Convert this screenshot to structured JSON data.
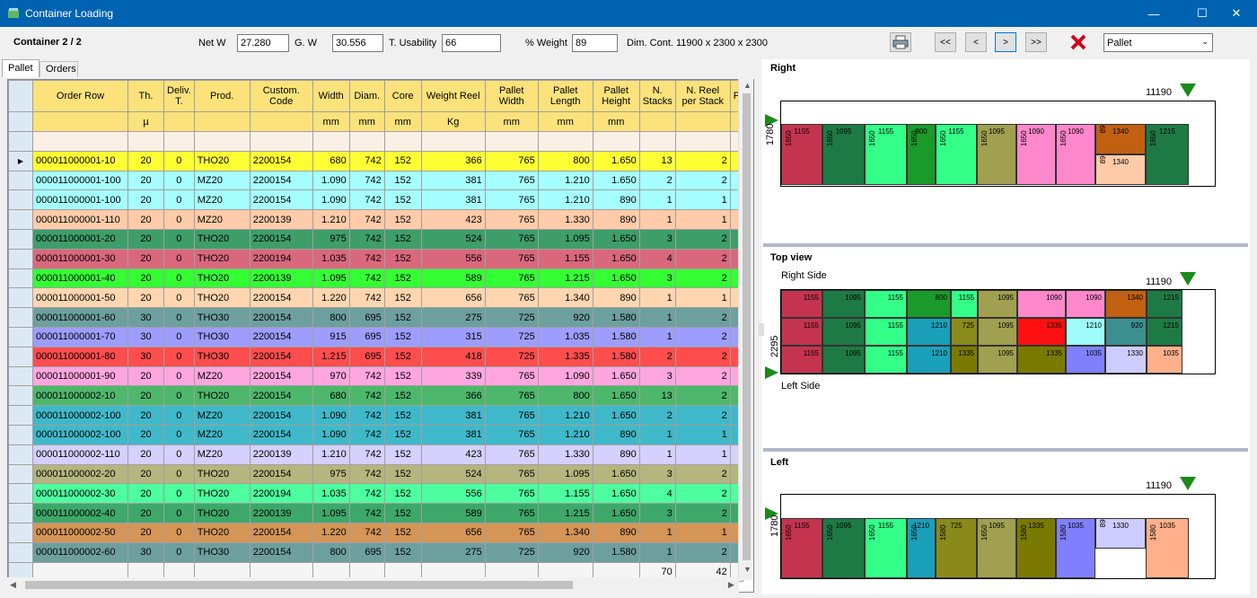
{
  "window": {
    "title": "Container Loading",
    "min": "—",
    "max": "☐",
    "close": "✕"
  },
  "toolbar": {
    "container_label": "Container 2 / 2",
    "netw_label": "Net W",
    "netw_value": "27.280",
    "gw_label": "G. W",
    "gw_value": "30.556",
    "usab_label": "T. Usability",
    "usab_value": "66",
    "pweight_label": "% Weight",
    "pweight_value": "89",
    "dim_label": "Dim. Cont. 11900 x 2300 x 2300",
    "first": "<<",
    "prev": "<",
    "next": ">",
    "last": ">>",
    "select_value": "Pallet"
  },
  "tabs": [
    "Pallet",
    "Orders"
  ],
  "grid": {
    "headers": [
      "Order Row",
      "Th.",
      "Deliv. T.",
      "Prod.",
      "Custom. Code",
      "Width",
      "Diam.",
      "Core",
      "Weight Reel",
      "Pallet Width",
      "Pallet Length",
      "Pallet Height",
      "N. Stacks",
      "N. Reel per Stack",
      "P"
    ],
    "units": [
      "",
      "µ",
      "",
      "",
      "",
      "mm",
      "mm",
      "mm",
      "Kg",
      "mm",
      "mm",
      "mm",
      "",
      "",
      ""
    ],
    "rows": [
      [
        "000011000001-10",
        "20",
        "0",
        "THO20",
        "2200154",
        "680",
        "742",
        "152",
        "366",
        "765",
        "800",
        "1.650",
        "13",
        "2",
        "#ffff33"
      ],
      [
        "000011000001-100",
        "20",
        "0",
        "MZ20",
        "2200154",
        "1.090",
        "742",
        "152",
        "381",
        "765",
        "1.210",
        "1.650",
        "2",
        "2",
        "#a6ffff"
      ],
      [
        "000011000001-100",
        "20",
        "0",
        "MZ20",
        "2200154",
        "1.090",
        "742",
        "152",
        "381",
        "765",
        "1.210",
        "890",
        "1",
        "1",
        "#a6ffff"
      ],
      [
        "000011000001-110",
        "20",
        "0",
        "MZ20",
        "2200139",
        "1.210",
        "742",
        "152",
        "423",
        "765",
        "1.330",
        "890",
        "1",
        "1",
        "#ffcba8"
      ],
      [
        "000011000001-20",
        "20",
        "0",
        "THO20",
        "2200154",
        "975",
        "742",
        "152",
        "524",
        "765",
        "1.095",
        "1.650",
        "3",
        "2",
        "#3e9e6a"
      ],
      [
        "000011000001-30",
        "20",
        "0",
        "THO20",
        "2200194",
        "1.035",
        "742",
        "152",
        "556",
        "765",
        "1.155",
        "1.650",
        "4",
        "2",
        "#d9687d"
      ],
      [
        "000011000001-40",
        "20",
        "0",
        "THO20",
        "2200139",
        "1.095",
        "742",
        "152",
        "589",
        "765",
        "1.215",
        "1.650",
        "3",
        "2",
        "#33ff33"
      ],
      [
        "000011000001-50",
        "20",
        "0",
        "THO20",
        "2200154",
        "1.220",
        "742",
        "152",
        "656",
        "765",
        "1.340",
        "890",
        "1",
        "1",
        "#ffd6b0"
      ],
      [
        "000011000001-60",
        "30",
        "0",
        "THO30",
        "2200154",
        "800",
        "695",
        "152",
        "275",
        "725",
        "920",
        "1.580",
        "1",
        "2",
        "#6e9f9f"
      ],
      [
        "000011000001-70",
        "30",
        "0",
        "THO30",
        "2200154",
        "915",
        "695",
        "152",
        "315",
        "725",
        "1.035",
        "1.580",
        "1",
        "2",
        "#9d9dff"
      ],
      [
        "000011000001-80",
        "30",
        "0",
        "THO30",
        "2200154",
        "1.215",
        "695",
        "152",
        "418",
        "725",
        "1.335",
        "1.580",
        "2",
        "2",
        "#ff4d4d"
      ],
      [
        "000011000001-90",
        "20",
        "0",
        "MZ20",
        "2200154",
        "970",
        "742",
        "152",
        "339",
        "765",
        "1.090",
        "1.650",
        "3",
        "2",
        "#ffa6e0"
      ],
      [
        "000011000002-10",
        "20",
        "0",
        "THO20",
        "2200154",
        "680",
        "742",
        "152",
        "366",
        "765",
        "800",
        "1.650",
        "13",
        "2",
        "#4db86b"
      ],
      [
        "000011000002-100",
        "20",
        "0",
        "MZ20",
        "2200154",
        "1.090",
        "742",
        "152",
        "381",
        "765",
        "1.210",
        "1.650",
        "2",
        "2",
        "#3fb9c9"
      ],
      [
        "000011000002-100",
        "20",
        "0",
        "MZ20",
        "2200154",
        "1.090",
        "742",
        "152",
        "381",
        "765",
        "1.210",
        "890",
        "1",
        "1",
        "#3fb9c9"
      ],
      [
        "000011000002-110",
        "20",
        "0",
        "MZ20",
        "2200139",
        "1.210",
        "742",
        "152",
        "423",
        "765",
        "1.330",
        "890",
        "1",
        "1",
        "#d4d0ff"
      ],
      [
        "000011000002-20",
        "20",
        "0",
        "THO20",
        "2200154",
        "975",
        "742",
        "152",
        "524",
        "765",
        "1.095",
        "1.650",
        "3",
        "2",
        "#b5b57e"
      ],
      [
        "000011000002-30",
        "20",
        "0",
        "THO20",
        "2200194",
        "1.035",
        "742",
        "152",
        "556",
        "765",
        "1.155",
        "1.650",
        "4",
        "2",
        "#4dff9e"
      ],
      [
        "000011000002-40",
        "20",
        "0",
        "THO20",
        "2200139",
        "1.095",
        "742",
        "152",
        "589",
        "765",
        "1.215",
        "1.650",
        "3",
        "2",
        "#3da86a"
      ],
      [
        "000011000002-50",
        "20",
        "0",
        "THO20",
        "2200154",
        "1.220",
        "742",
        "152",
        "656",
        "765",
        "1.340",
        "890",
        "1",
        "1",
        "#d49557"
      ],
      [
        "000011000002-60",
        "30",
        "0",
        "THO30",
        "2200154",
        "800",
        "695",
        "152",
        "275",
        "725",
        "920",
        "1.580",
        "1",
        "2",
        "#6e9f9f"
      ]
    ],
    "totals": {
      "stacks": "70",
      "reels": "42"
    }
  },
  "views": {
    "right": {
      "title": "Right",
      "length": "11190",
      "height": "1780"
    },
    "top": {
      "title": "Top view",
      "right_side": "Right Side",
      "left_side": "Left Side",
      "length": "11190",
      "width": "2295"
    },
    "left": {
      "title": "Left",
      "length": "11190",
      "height": "1780"
    }
  },
  "blocks": {
    "right": [
      {
        "c": "#c4344f",
        "w": "1155",
        "h": "1650"
      },
      {
        "c": "#1e7a45",
        "w": "1095",
        "h": "1650"
      },
      {
        "c": "#33ff88",
        "w": "1155",
        "h": "1650"
      },
      {
        "c": "#1a9a2a",
        "w": "800",
        "h": "1650"
      },
      {
        "c": "#33ff88",
        "w": "1155",
        "h": "1650"
      },
      {
        "c": "#a0a050",
        "w": "1095",
        "h": "1650"
      },
      {
        "c": "#ff88cc",
        "w": "1090",
        "h": "1650"
      },
      {
        "c": "#ff88cc",
        "w": "1090",
        "h": "1650"
      },
      {
        "c": "#c06010",
        "w": "1340",
        "h": "890"
      },
      {
        "c": "#ffcba8",
        "w": "1340",
        "h": "890"
      },
      {
        "c": "#1e7a45",
        "w": "1215",
        "h": "1650"
      }
    ],
    "top": [
      [
        "1155",
        "1095",
        "1155",
        "800",
        "1155",
        "1095",
        "1090",
        "1090",
        "1340",
        "1215"
      ],
      [
        "1155",
        "1095",
        "1155",
        "1210",
        "725",
        "1095",
        "1335",
        "1210",
        "920",
        "1215"
      ],
      [
        "1155",
        "1095",
        "1155",
        "1210",
        "1335",
        "1095",
        "1335",
        "1035",
        "1330",
        "1035"
      ]
    ],
    "left": [
      {
        "c": "#c4344f",
        "w": "1155",
        "h": "1650"
      },
      {
        "c": "#1e7a45",
        "w": "1095",
        "h": "1650"
      },
      {
        "c": "#33ff88",
        "w": "1155",
        "h": "1650"
      },
      {
        "c": "#1aa0b8",
        "w": "1210",
        "h": "1650"
      },
      {
        "c": "#8a8a1a",
        "w": "725",
        "h": "1580"
      },
      {
        "c": "#a0a050",
        "w": "1095",
        "h": "1650"
      },
      {
        "c": "#7a7a00",
        "w": "1335",
        "h": "1580"
      },
      {
        "c": "#8080ff",
        "w": "1035",
        "h": "1580"
      },
      {
        "c": "#ccccff",
        "w": "1330",
        "h": "890"
      },
      {
        "c": "#ffb08a",
        "w": "1035",
        "h": "1580"
      }
    ]
  }
}
